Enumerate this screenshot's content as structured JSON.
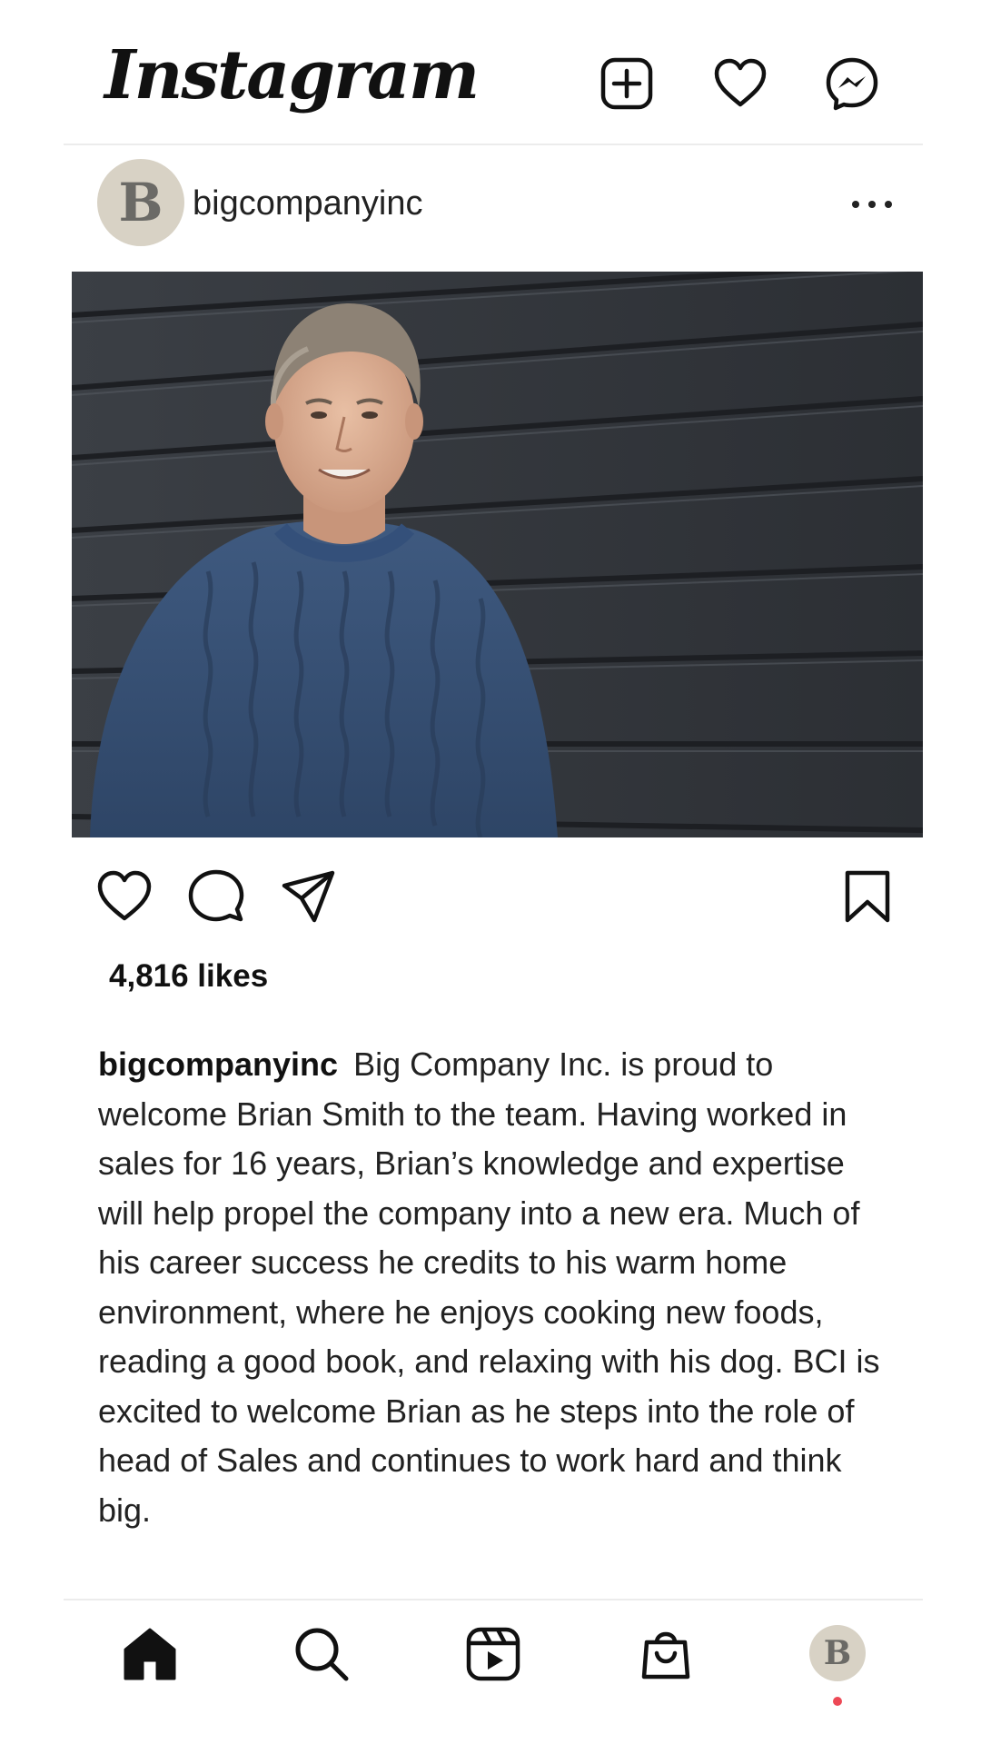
{
  "app": {
    "logo_text": "Instagram"
  },
  "header": {
    "icons": [
      "new-post-icon",
      "heart-icon",
      "messenger-icon"
    ]
  },
  "post": {
    "username": "bigcompanyinc",
    "avatar_letter": "B",
    "likes": "4,816 likes",
    "caption_user": "bigcompanyinc",
    "caption_text": "Big Company Inc. is proud to welcome Brian Smith to the team. Having worked in sales for 16 years, Brian’s knowledge and expertise will help propel the company into a new era. Much of his career success he credits to his warm home environment, where he enjoys cooking new foods, reading a good book, and relaxing with his dog. BCI is excited to welcome Brian as he steps into the role of head of Sales and continues to work hard and think big.",
    "image": "photo of a smiling grey-haired man in a blue cable-knit sweater leaning against dark wooden siding",
    "actions": [
      "heart-icon",
      "comment-icon",
      "share-icon",
      "bookmark-icon"
    ]
  },
  "bottom_nav": {
    "items": [
      "home-icon",
      "search-icon",
      "reels-icon",
      "shop-icon",
      "profile-avatar"
    ],
    "profile_letter": "B"
  },
  "colors": {
    "avatar_bg": "#d8d2c5",
    "notification_dot": "#ed4956",
    "divider": "#ececec"
  }
}
